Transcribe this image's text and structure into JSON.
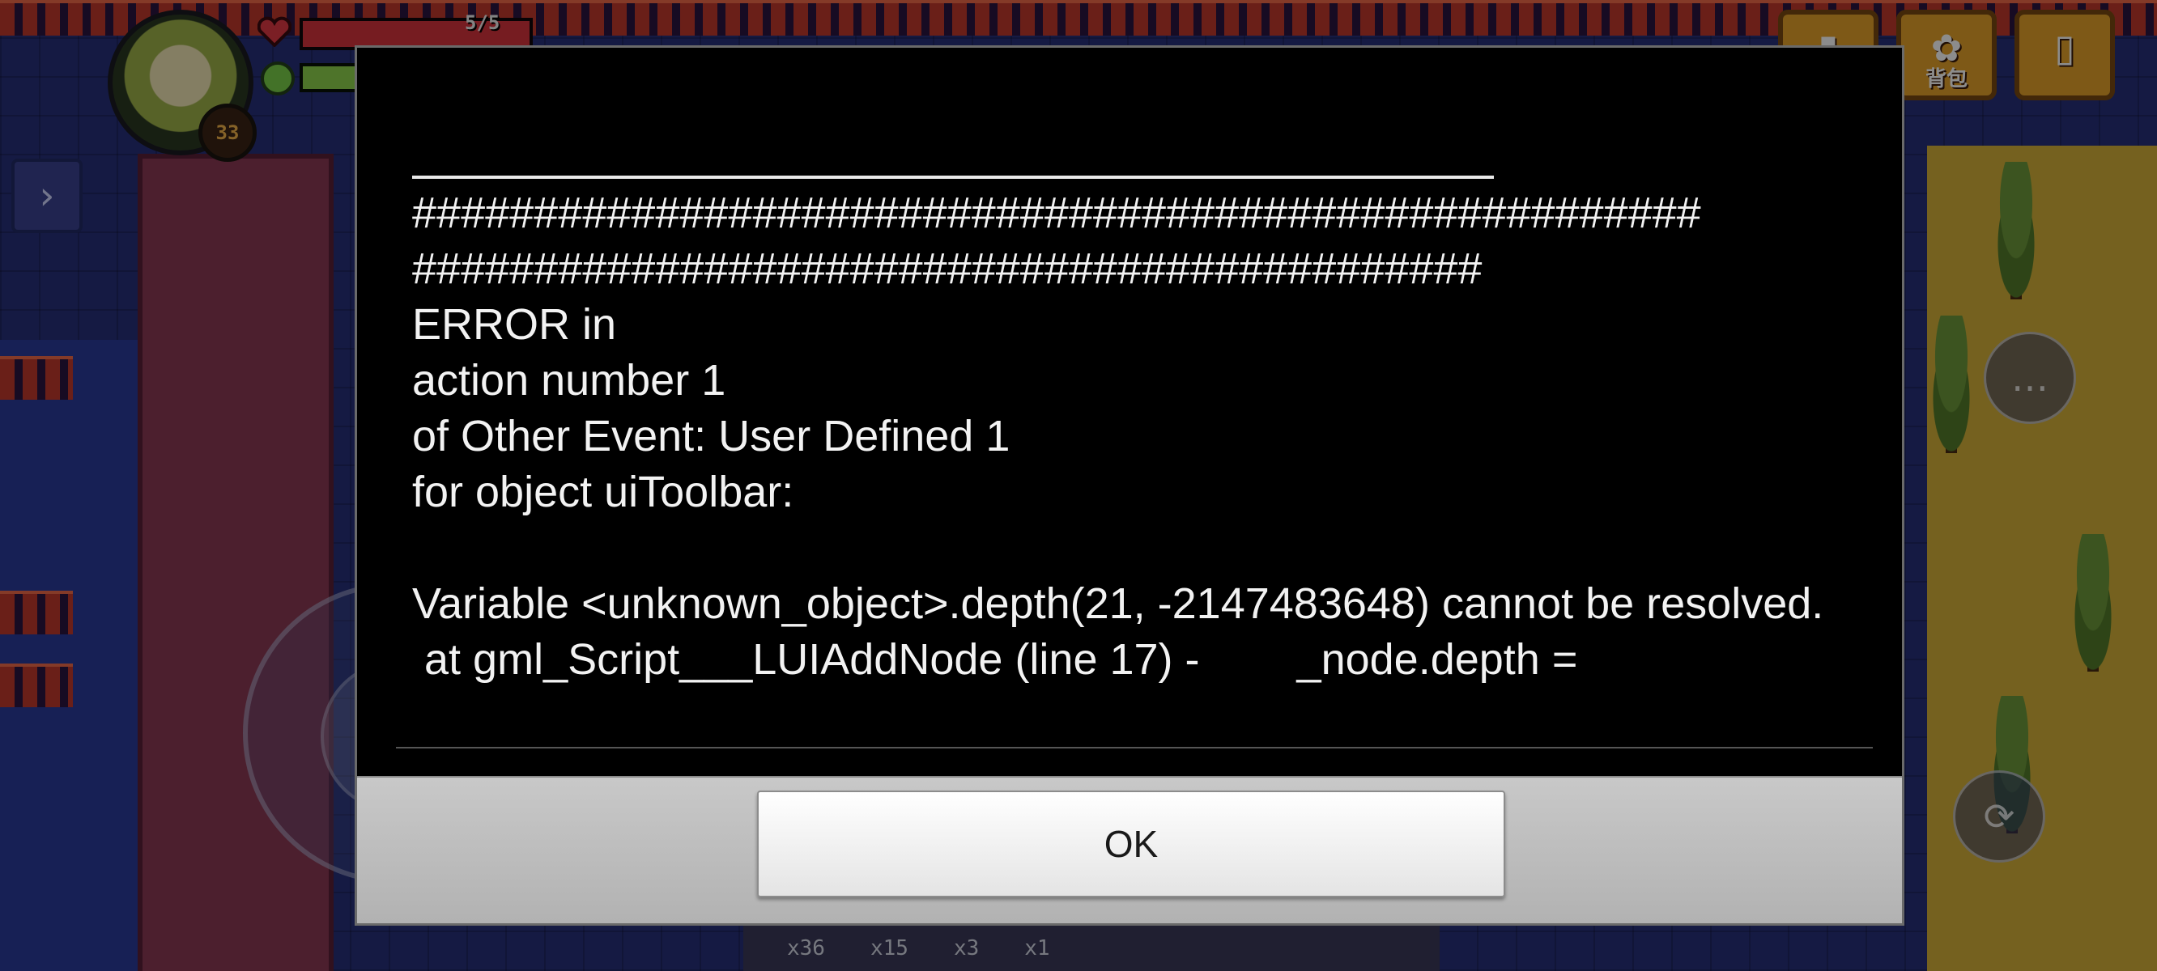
{
  "hud": {
    "hp_text": "5/5",
    "hp_fraction": 1.0,
    "energy_fraction": 0.35,
    "level": "33",
    "side_expand_glyph": "›",
    "icons": [
      "heart-icon",
      "energy-icon",
      "chat-icon",
      "dodge-icon"
    ]
  },
  "top_buttons": [
    {
      "label": "",
      "glyph": "▮",
      "icon": "phone-icon"
    },
    {
      "label": "背包",
      "glyph": "✿",
      "icon": "backpack-icon"
    },
    {
      "label": "",
      "glyph": "▯",
      "icon": "scroll-icon"
    }
  ],
  "hotbar": [
    "x36",
    "x15",
    "x3",
    "x1"
  ],
  "dialog": {
    "message": "#####################################################\n############################################\nERROR in\naction number 1\nof Other Event: User Defined 1\nfor object uiToolbar:\n\nVariable <unknown_object>.depth(21, -2147483648) cannot be resolved.\n at gml_Script___LUIAddNode (line 17) -        _node.depth =",
    "ok_label": "OK"
  },
  "colors": {
    "dialog_background": "#000000",
    "dialog_text": "#f2f2f2",
    "footer_background": "#bfbfbf",
    "hp_fill": "#d8343c",
    "energy_fill": "#8ed34e"
  }
}
